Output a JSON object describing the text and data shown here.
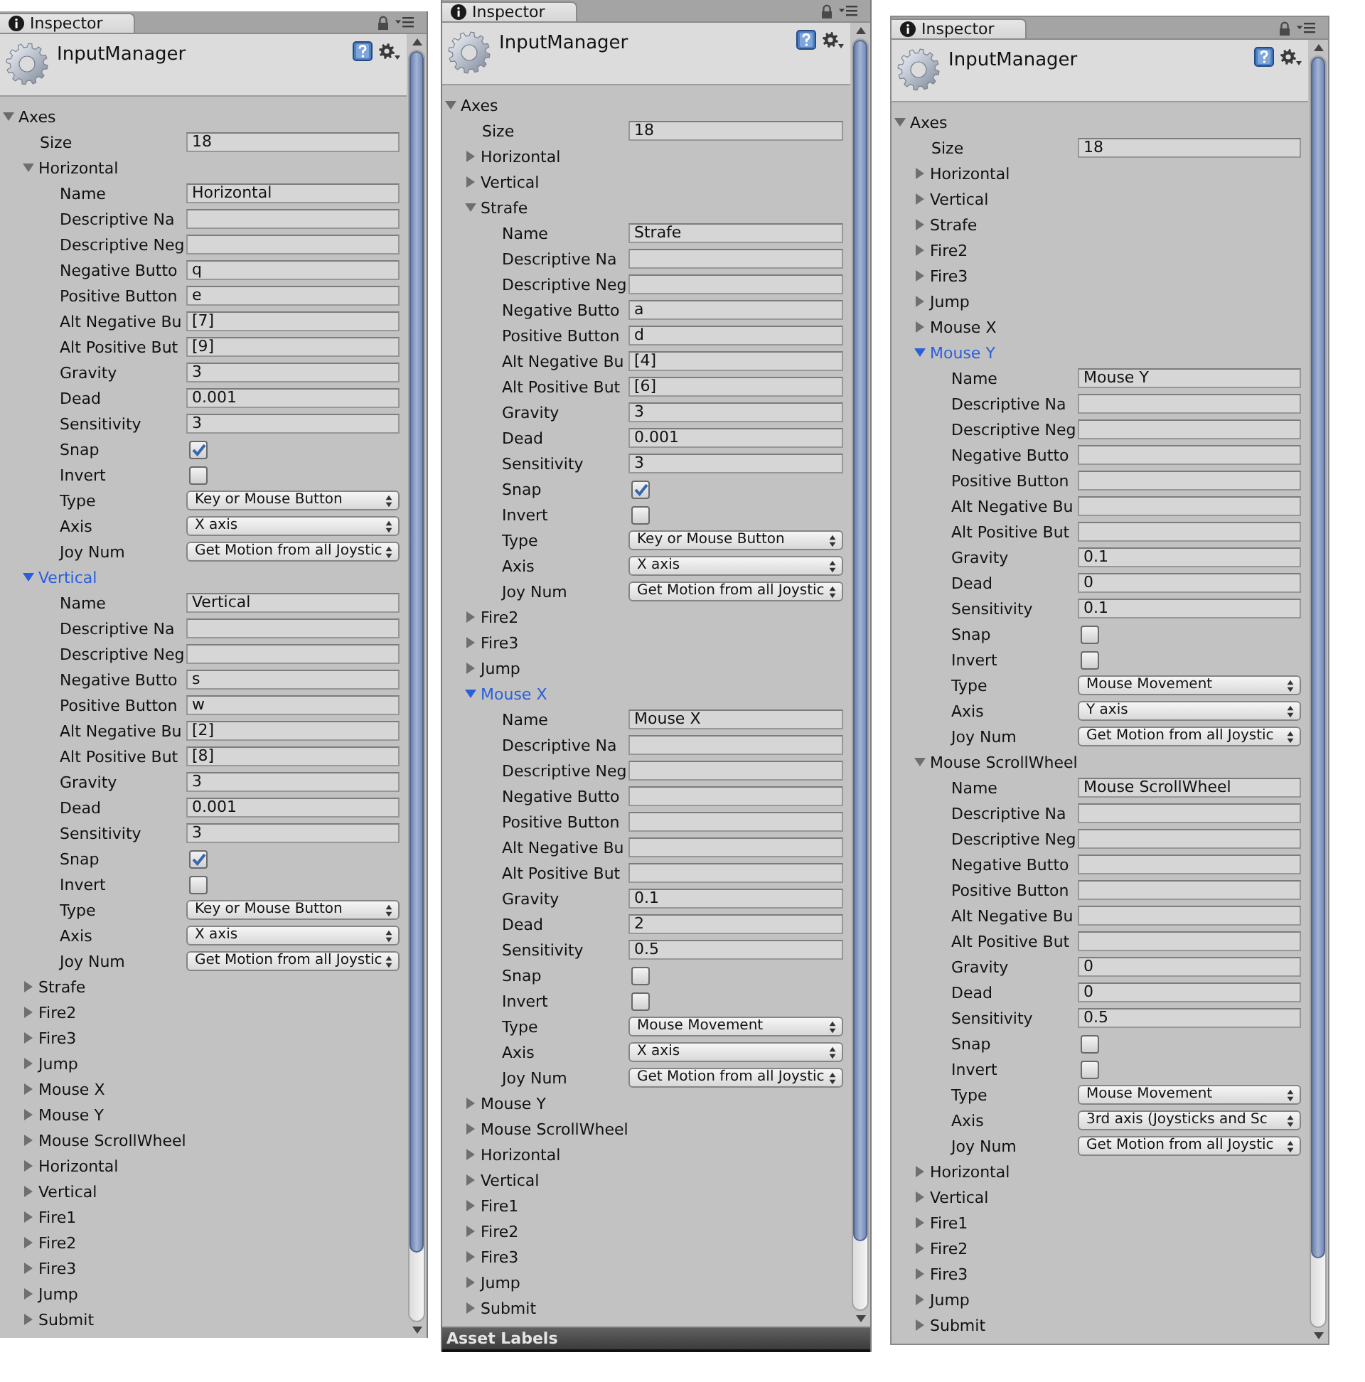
{
  "panels": [
    {
      "tab": "Inspector",
      "title": "InputManager",
      "axes": {
        "label": "Axes",
        "expanded": true,
        "size_label": "Size",
        "size": "18",
        "items": [
          {
            "label": "Horizontal",
            "expanded": true,
            "selected": false,
            "fields": [
              {
                "kind": "text",
                "label": "Name",
                "value": "Horizontal"
              },
              {
                "kind": "text",
                "label": "Descriptive Na"
              },
              {
                "kind": "text",
                "label": "Descriptive Neg"
              },
              {
                "kind": "text",
                "label": "Negative Butto",
                "value": "q"
              },
              {
                "kind": "text",
                "label": "Positive Button",
                "value": "e"
              },
              {
                "kind": "text",
                "label": "Alt Negative Bu",
                "value": "[7]"
              },
              {
                "kind": "text",
                "label": "Alt Positive But",
                "value": "[9]"
              },
              {
                "kind": "text",
                "label": "Gravity",
                "value": "3"
              },
              {
                "kind": "text",
                "label": "Dead",
                "value": "0.001"
              },
              {
                "kind": "text",
                "label": "Sensitivity",
                "value": "3"
              },
              {
                "kind": "checkbox",
                "label": "Snap",
                "checked": true
              },
              {
                "kind": "checkbox",
                "label": "Invert",
                "checked": false
              },
              {
                "kind": "dropdown",
                "label": "Type",
                "value": "Key or Mouse Button"
              },
              {
                "kind": "dropdown",
                "label": "Axis",
                "value": "X axis"
              },
              {
                "kind": "dropdown",
                "label": "Joy Num",
                "value": "Get Motion from all Joystic"
              }
            ]
          },
          {
            "label": "Vertical",
            "expanded": true,
            "selected": true,
            "fields": [
              {
                "kind": "text",
                "label": "Name",
                "value": "Vertical"
              },
              {
                "kind": "text",
                "label": "Descriptive Na"
              },
              {
                "kind": "text",
                "label": "Descriptive Neg"
              },
              {
                "kind": "text",
                "label": "Negative Butto",
                "value": "s"
              },
              {
                "kind": "text",
                "label": "Positive Button",
                "value": "w"
              },
              {
                "kind": "text",
                "label": "Alt Negative Bu",
                "value": "[2]"
              },
              {
                "kind": "text",
                "label": "Alt Positive But",
                "value": "[8]"
              },
              {
                "kind": "text",
                "label": "Gravity",
                "value": "3"
              },
              {
                "kind": "text",
                "label": "Dead",
                "value": "0.001"
              },
              {
                "kind": "text",
                "label": "Sensitivity",
                "value": "3"
              },
              {
                "kind": "checkbox",
                "label": "Snap",
                "checked": true
              },
              {
                "kind": "checkbox",
                "label": "Invert",
                "checked": false
              },
              {
                "kind": "dropdown",
                "label": "Type",
                "value": "Key or Mouse Button"
              },
              {
                "kind": "dropdown",
                "label": "Axis",
                "value": "X axis"
              },
              {
                "kind": "dropdown",
                "label": "Joy Num",
                "value": "Get Motion from all Joystic"
              }
            ]
          },
          {
            "label": "Strafe",
            "expanded": false,
            "selected": false
          },
          {
            "label": "Fire2",
            "expanded": false,
            "selected": false
          },
          {
            "label": "Fire3",
            "expanded": false,
            "selected": false
          },
          {
            "label": "Jump",
            "expanded": false,
            "selected": false
          },
          {
            "label": "Mouse X",
            "expanded": false,
            "selected": false
          },
          {
            "label": "Mouse Y",
            "expanded": false,
            "selected": false
          },
          {
            "label": "Mouse ScrollWheel",
            "expanded": false,
            "selected": false
          },
          {
            "label": "Horizontal",
            "expanded": false,
            "selected": false
          },
          {
            "label": "Vertical",
            "expanded": false,
            "selected": false
          },
          {
            "label": "Fire1",
            "expanded": false,
            "selected": false
          },
          {
            "label": "Fire2",
            "expanded": false,
            "selected": false
          },
          {
            "label": "Fire3",
            "expanded": false,
            "selected": false
          },
          {
            "label": "Jump",
            "expanded": false,
            "selected": false
          },
          {
            "label": "Submit",
            "expanded": false,
            "selected": false
          }
        ]
      }
    },
    {
      "tab": "Inspector",
      "title": "InputManager",
      "axes": {
        "label": "Axes",
        "expanded": true,
        "size_label": "Size",
        "size": "18",
        "items": [
          {
            "label": "Horizontal",
            "expanded": false,
            "selected": false
          },
          {
            "label": "Vertical",
            "expanded": false,
            "selected": false
          },
          {
            "label": "Strafe",
            "expanded": true,
            "selected": false,
            "fields": [
              {
                "kind": "text",
                "label": "Name",
                "value": "Strafe"
              },
              {
                "kind": "text",
                "label": "Descriptive Na"
              },
              {
                "kind": "text",
                "label": "Descriptive Neg"
              },
              {
                "kind": "text",
                "label": "Negative Butto",
                "value": "a"
              },
              {
                "kind": "text",
                "label": "Positive Button",
                "value": "d"
              },
              {
                "kind": "text",
                "label": "Alt Negative Bu",
                "value": "[4]"
              },
              {
                "kind": "text",
                "label": "Alt Positive But",
                "value": "[6]"
              },
              {
                "kind": "text",
                "label": "Gravity",
                "value": "3"
              },
              {
                "kind": "text",
                "label": "Dead",
                "value": "0.001"
              },
              {
                "kind": "text",
                "label": "Sensitivity",
                "value": "3"
              },
              {
                "kind": "checkbox",
                "label": "Snap",
                "checked": true
              },
              {
                "kind": "checkbox",
                "label": "Invert",
                "checked": false
              },
              {
                "kind": "dropdown",
                "label": "Type",
                "value": "Key or Mouse Button"
              },
              {
                "kind": "dropdown",
                "label": "Axis",
                "value": "X axis"
              },
              {
                "kind": "dropdown",
                "label": "Joy Num",
                "value": "Get Motion from all Joystic"
              }
            ]
          },
          {
            "label": "Fire2",
            "expanded": false,
            "selected": false
          },
          {
            "label": "Fire3",
            "expanded": false,
            "selected": false
          },
          {
            "label": "Jump",
            "expanded": false,
            "selected": false
          },
          {
            "label": "Mouse X",
            "expanded": true,
            "selected": true,
            "fields": [
              {
                "kind": "text",
                "label": "Name",
                "value": "Mouse X"
              },
              {
                "kind": "text",
                "label": "Descriptive Na"
              },
              {
                "kind": "text",
                "label": "Descriptive Neg"
              },
              {
                "kind": "text",
                "label": "Negative Butto"
              },
              {
                "kind": "text",
                "label": "Positive Button"
              },
              {
                "kind": "text",
                "label": "Alt Negative Bu"
              },
              {
                "kind": "text",
                "label": "Alt Positive But"
              },
              {
                "kind": "text",
                "label": "Gravity",
                "value": "0.1"
              },
              {
                "kind": "text",
                "label": "Dead",
                "value": "2"
              },
              {
                "kind": "text",
                "label": "Sensitivity",
                "value": "0.5"
              },
              {
                "kind": "checkbox",
                "label": "Snap",
                "checked": false
              },
              {
                "kind": "checkbox",
                "label": "Invert",
                "checked": false
              },
              {
                "kind": "dropdown",
                "label": "Type",
                "value": "Mouse Movement"
              },
              {
                "kind": "dropdown",
                "label": "Axis",
                "value": "X axis"
              },
              {
                "kind": "dropdown",
                "label": "Joy Num",
                "value": "Get Motion from all Joystic"
              }
            ]
          },
          {
            "label": "Mouse Y",
            "expanded": false,
            "selected": false
          },
          {
            "label": "Mouse ScrollWheel",
            "expanded": false,
            "selected": false
          },
          {
            "label": "Horizontal",
            "expanded": false,
            "selected": false
          },
          {
            "label": "Vertical",
            "expanded": false,
            "selected": false
          },
          {
            "label": "Fire1",
            "expanded": false,
            "selected": false
          },
          {
            "label": "Fire2",
            "expanded": false,
            "selected": false
          },
          {
            "label": "Fire3",
            "expanded": false,
            "selected": false
          },
          {
            "label": "Jump",
            "expanded": false,
            "selected": false
          },
          {
            "label": "Submit",
            "expanded": false,
            "selected": false
          }
        ]
      },
      "footer": "Asset Labels"
    },
    {
      "tab": "Inspector",
      "title": "InputManager",
      "axes": {
        "label": "Axes",
        "expanded": true,
        "size_label": "Size",
        "size": "18",
        "items": [
          {
            "label": "Horizontal",
            "expanded": false,
            "selected": false
          },
          {
            "label": "Vertical",
            "expanded": false,
            "selected": false
          },
          {
            "label": "Strafe",
            "expanded": false,
            "selected": false
          },
          {
            "label": "Fire2",
            "expanded": false,
            "selected": false
          },
          {
            "label": "Fire3",
            "expanded": false,
            "selected": false
          },
          {
            "label": "Jump",
            "expanded": false,
            "selected": false
          },
          {
            "label": "Mouse X",
            "expanded": false,
            "selected": false
          },
          {
            "label": "Mouse Y",
            "expanded": true,
            "selected": true,
            "fields": [
              {
                "kind": "text",
                "label": "Name",
                "value": "Mouse Y"
              },
              {
                "kind": "text",
                "label": "Descriptive Na"
              },
              {
                "kind": "text",
                "label": "Descriptive Neg"
              },
              {
                "kind": "text",
                "label": "Negative Butto"
              },
              {
                "kind": "text",
                "label": "Positive Button"
              },
              {
                "kind": "text",
                "label": "Alt Negative Bu"
              },
              {
                "kind": "text",
                "label": "Alt Positive But"
              },
              {
                "kind": "text",
                "label": "Gravity",
                "value": "0.1"
              },
              {
                "kind": "text",
                "label": "Dead",
                "value": "0"
              },
              {
                "kind": "text",
                "label": "Sensitivity",
                "value": "0.1"
              },
              {
                "kind": "checkbox",
                "label": "Snap",
                "checked": false
              },
              {
                "kind": "checkbox",
                "label": "Invert",
                "checked": false
              },
              {
                "kind": "dropdown",
                "label": "Type",
                "value": "Mouse Movement"
              },
              {
                "kind": "dropdown",
                "label": "Axis",
                "value": "Y axis"
              },
              {
                "kind": "dropdown",
                "label": "Joy Num",
                "value": "Get Motion from all Joystic"
              }
            ]
          },
          {
            "label": "Mouse ScrollWheel",
            "expanded": true,
            "selected": false,
            "fields": [
              {
                "kind": "text",
                "label": "Name",
                "value": "Mouse ScrollWheel"
              },
              {
                "kind": "text",
                "label": "Descriptive Na"
              },
              {
                "kind": "text",
                "label": "Descriptive Neg"
              },
              {
                "kind": "text",
                "label": "Negative Butto"
              },
              {
                "kind": "text",
                "label": "Positive Button"
              },
              {
                "kind": "text",
                "label": "Alt Negative Bu"
              },
              {
                "kind": "text",
                "label": "Alt Positive But"
              },
              {
                "kind": "text",
                "label": "Gravity",
                "value": "0"
              },
              {
                "kind": "text",
                "label": "Dead",
                "value": "0"
              },
              {
                "kind": "text",
                "label": "Sensitivity",
                "value": "0.5"
              },
              {
                "kind": "checkbox",
                "label": "Snap",
                "checked": false
              },
              {
                "kind": "checkbox",
                "label": "Invert",
                "checked": false
              },
              {
                "kind": "dropdown",
                "label": "Type",
                "value": "Mouse Movement"
              },
              {
                "kind": "dropdown",
                "label": "Axis",
                "value": "3rd axis (Joysticks and Sc"
              },
              {
                "kind": "dropdown",
                "label": "Joy Num",
                "value": "Get Motion from all Joystic"
              }
            ]
          },
          {
            "label": "Horizontal",
            "expanded": false,
            "selected": false
          },
          {
            "label": "Vertical",
            "expanded": false,
            "selected": false
          },
          {
            "label": "Fire1",
            "expanded": false,
            "selected": false
          },
          {
            "label": "Fire2",
            "expanded": false,
            "selected": false
          },
          {
            "label": "Fire3",
            "expanded": false,
            "selected": false
          },
          {
            "label": "Jump",
            "expanded": false,
            "selected": false
          },
          {
            "label": "Submit",
            "expanded": false,
            "selected": false
          }
        ]
      }
    }
  ]
}
